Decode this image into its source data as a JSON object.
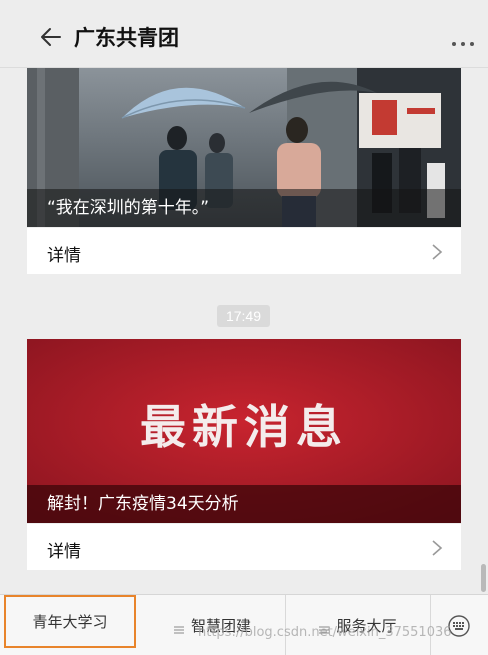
{
  "window": {
    "pin_icon": "pin-icon",
    "minimize_icon": "minimize-icon",
    "maximize_icon": "maximize-icon",
    "close_icon": "close-icon"
  },
  "header": {
    "title": "广东共青团",
    "back_icon": "arrow-left-icon",
    "more_icon": "more-dots-icon"
  },
  "feed": {
    "items": [
      {
        "caption": "“我在深圳的第十年。”",
        "detail_label": "详情",
        "chevron_icon": "chevron-right-icon"
      },
      {
        "timestamp": "17:49",
        "banner_text": "最新消息",
        "caption": "解封！广东疫情34天分析",
        "detail_label": "详情",
        "chevron_icon": "chevron-right-icon"
      }
    ]
  },
  "menu": {
    "items": [
      {
        "label": "青年大学习",
        "active": true
      },
      {
        "label": "智慧团建",
        "icon": "menu-lines-icon"
      },
      {
        "label": "服务大厅",
        "icon": "menu-lines-icon"
      }
    ],
    "keyboard_icon": "keyboard-icon"
  },
  "watermark": "https://blog.csdn.net/weixin_37551036",
  "colors": {
    "active_border": "#e8842b",
    "banner_red": "#b4202a",
    "background": "#ededed"
  }
}
